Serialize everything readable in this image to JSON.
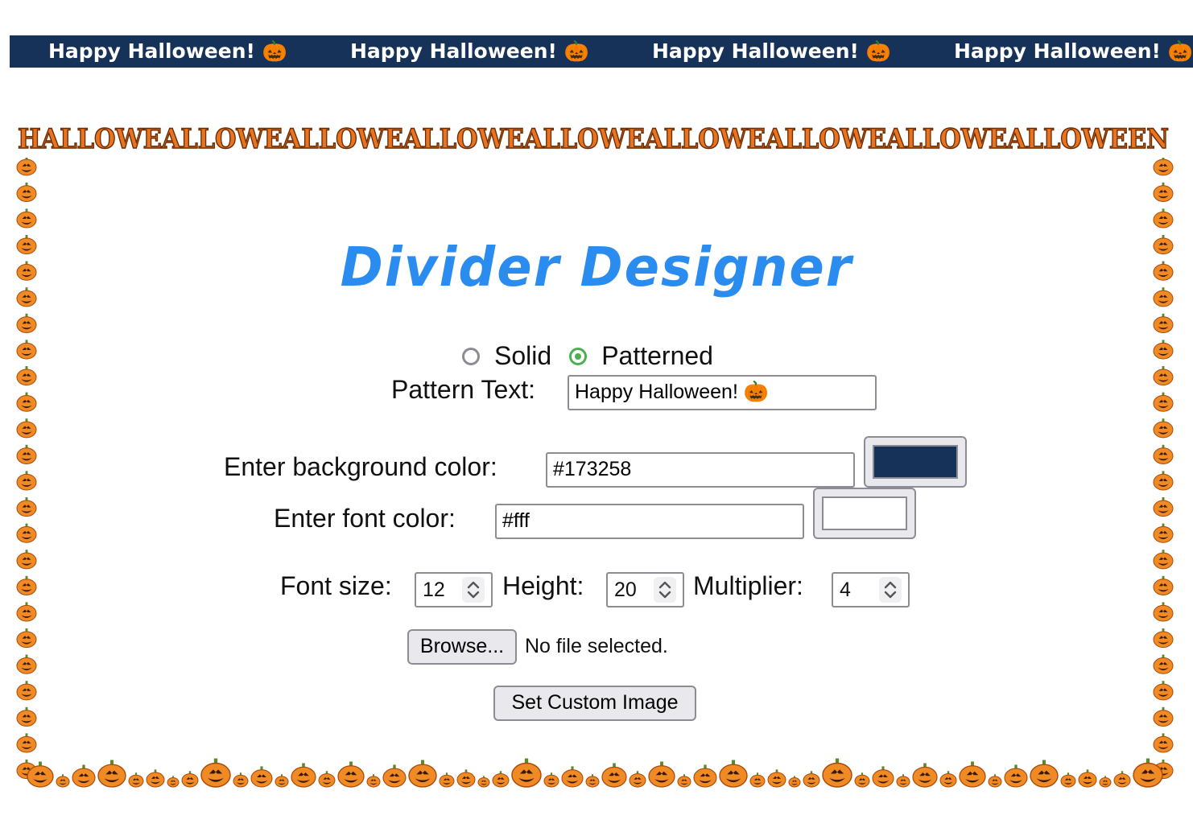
{
  "colors": {
    "divider_bg": "#173258",
    "divider_text": "#ffffff",
    "title": "#2b8cf0",
    "pumpkin": "#f08a24",
    "pumpkin_dark": "#a84a0a",
    "stem": "#5a8a2a",
    "frame_letter": "#e8741f"
  },
  "divider": {
    "items": [
      "Happy Halloween! 🎃",
      "Happy Halloween! 🎃",
      "Happy Halloween! 🎃",
      "Happy Halloween! 🎃"
    ]
  },
  "frame": {
    "top_text": "HALLOWEALLOWEALLOWEALLOWEALLOWEALLOWEALLOWEALLOWEALLOWEEN",
    "side_icon": "pumpkin-icon",
    "bottom_icon": "pumpkin-icon"
  },
  "page": {
    "title": "Divider Designer"
  },
  "divider_type": {
    "options": [
      {
        "label": "Solid",
        "selected": false
      },
      {
        "label": "Patterned",
        "selected": true
      }
    ]
  },
  "pattern": {
    "label": "Pattern Text:",
    "value": "Happy Halloween! 🎃"
  },
  "background_color": {
    "label": "Enter background color:",
    "value": "#173258",
    "swatch": "#173258"
  },
  "font_color": {
    "label": "Enter font color:",
    "value": "#fff",
    "swatch": "#ffffff"
  },
  "sizes": {
    "font_size_label": "Font size:",
    "font_size_value": "12",
    "height_label": "Height:",
    "height_value": "20",
    "multiplier_label": "Multiplier:",
    "multiplier_value": "4"
  },
  "file": {
    "browse_label": "Browse...",
    "status": "No file selected."
  },
  "actions": {
    "set_custom_image_label": "Set Custom Image"
  }
}
